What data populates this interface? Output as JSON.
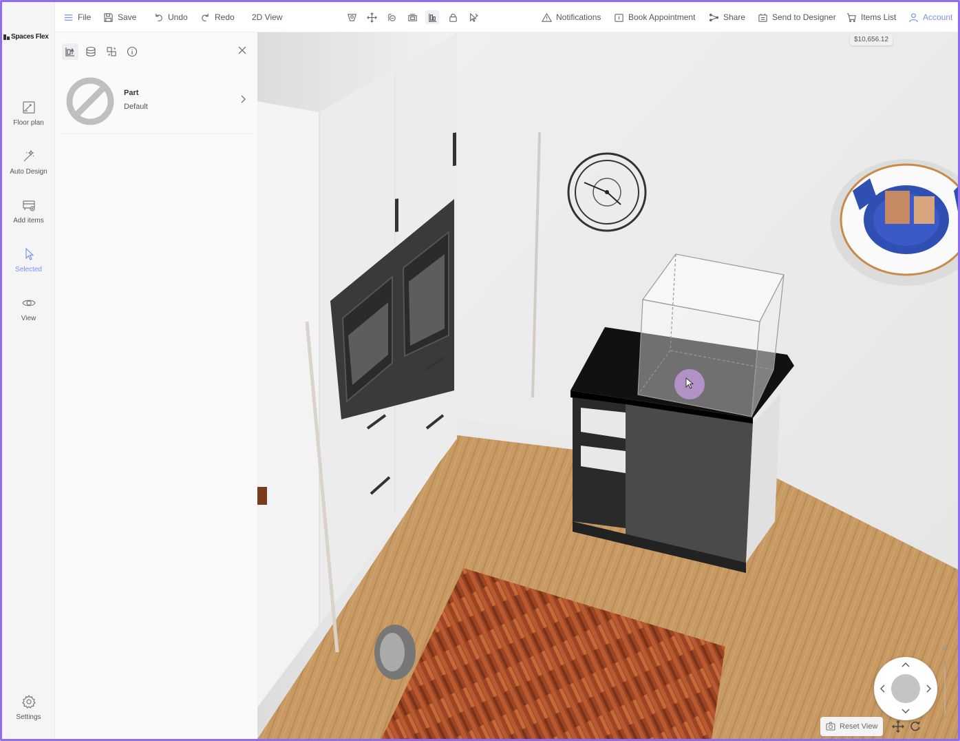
{
  "brand": {
    "name": "Spaces Flex"
  },
  "rail": {
    "items": [
      {
        "label": "Floor plan",
        "icon": "floor-plan-icon"
      },
      {
        "label": "Auto Design",
        "icon": "magic-wand-icon"
      },
      {
        "label": "Add items",
        "icon": "add-items-icon"
      },
      {
        "label": "Selected",
        "icon": "cursor-icon",
        "active": true
      },
      {
        "label": "View",
        "icon": "eye-icon"
      }
    ],
    "settings": {
      "label": "Settings",
      "icon": "gear-icon"
    }
  },
  "topbar": {
    "file": "File",
    "save": "Save",
    "undo": "Undo",
    "redo": "Redo",
    "view2d": "2D View",
    "notifications": "Notifications",
    "book": "Book Appointment",
    "share": "Share",
    "send": "Send to Designer",
    "items_list": "Items List",
    "account": "Account",
    "tools": [
      "camera-icon",
      "move-icon",
      "360-view-icon",
      "layers-icon",
      "align-icon",
      "lock-icon",
      "select-icon"
    ]
  },
  "panel": {
    "tabs": [
      "properties-icon",
      "material-icon",
      "replace-icon",
      "info-icon"
    ],
    "part": {
      "title": "Part",
      "value": "Default"
    }
  },
  "viewport": {
    "price": "$10,656.12",
    "reset_view": "Reset View",
    "colors": {
      "accent": "#8f6cf0",
      "selected": "#7b8ff0"
    }
  }
}
